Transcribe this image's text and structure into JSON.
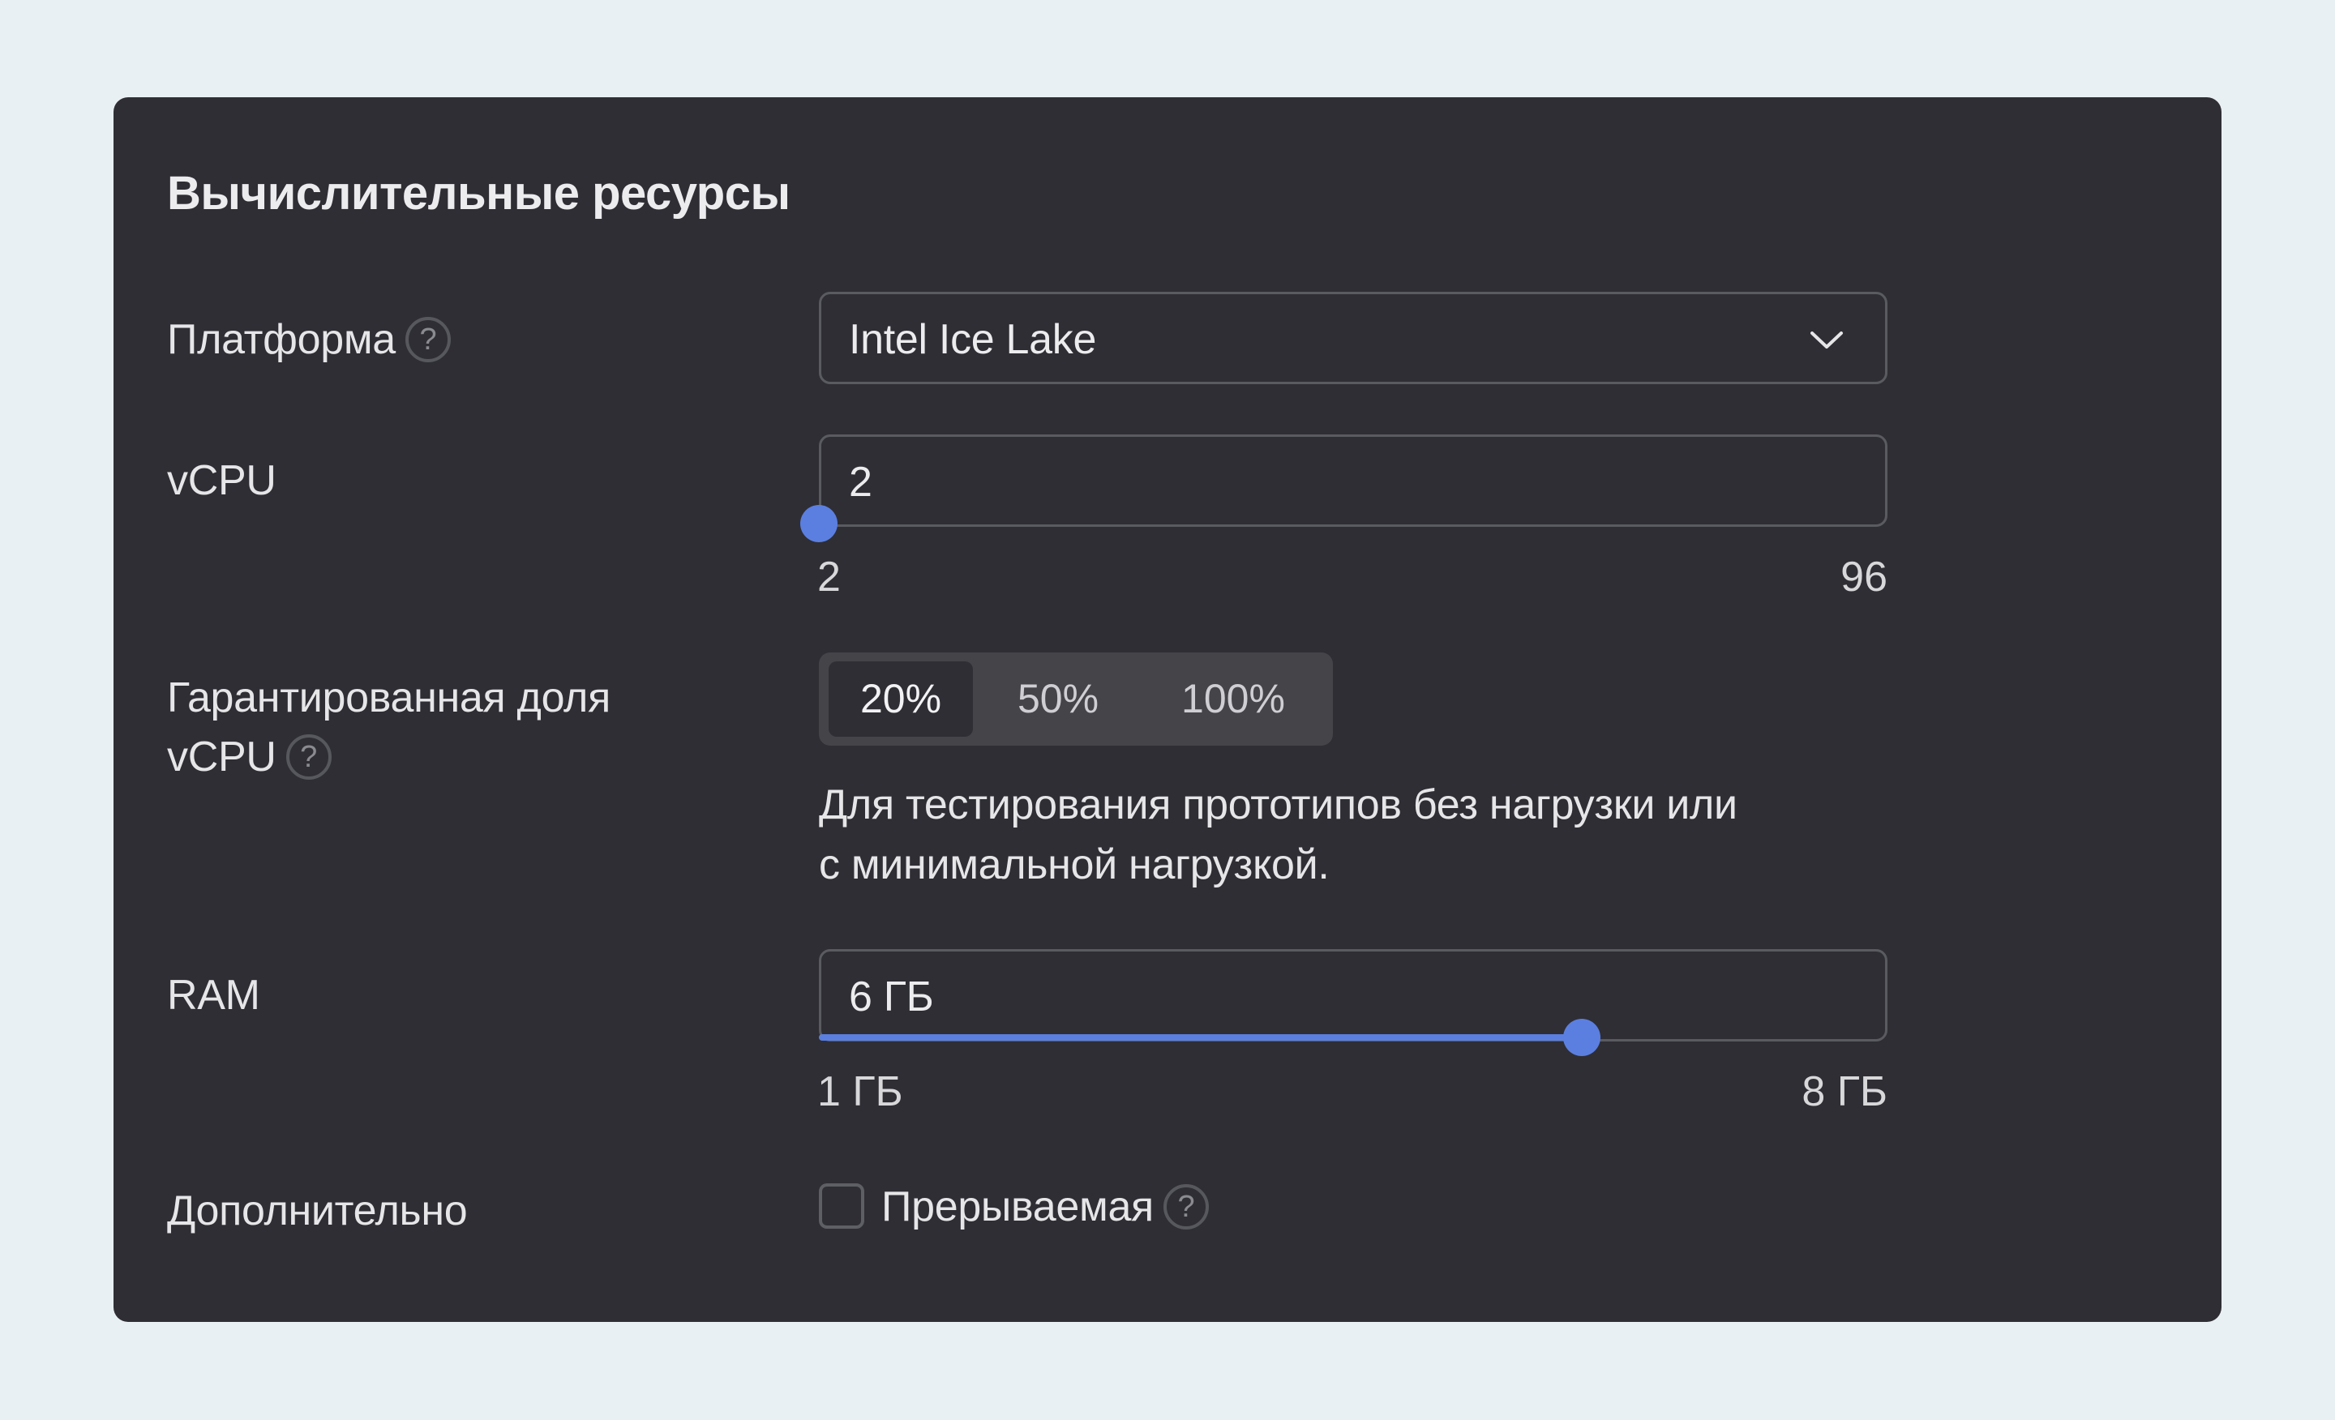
{
  "section": {
    "title": "Вычислительные ресурсы"
  },
  "platform": {
    "label": "Платформа",
    "help": "?",
    "value": "Intel Ice Lake",
    "icon": "chevron-down-icon"
  },
  "vcpu": {
    "label": "vCPU",
    "value": "2",
    "min_label": "2",
    "max_label": "96",
    "slider_fraction": 0.0
  },
  "guaranteed_share": {
    "label_line1": "Гарантированная доля",
    "label_line2": "vCPU",
    "help": "?",
    "options": [
      "20%",
      "50%",
      "100%"
    ],
    "selected": "20%",
    "description_line1": "Для тестирования прототипов без нагрузки или",
    "description_line2": "с минимальной нагрузкой."
  },
  "ram": {
    "label": "RAM",
    "value": "6 ГБ",
    "min_label": "1 ГБ",
    "max_label": "8 ГБ",
    "slider_fraction": 0.714
  },
  "additional": {
    "label": "Дополнительно",
    "preemptible_label": "Прерываемая",
    "preemptible_checked": false,
    "help": "?"
  },
  "colors": {
    "background": "#e9f0f4",
    "card": "#2e2e34",
    "accent": "#5b7fe0"
  }
}
